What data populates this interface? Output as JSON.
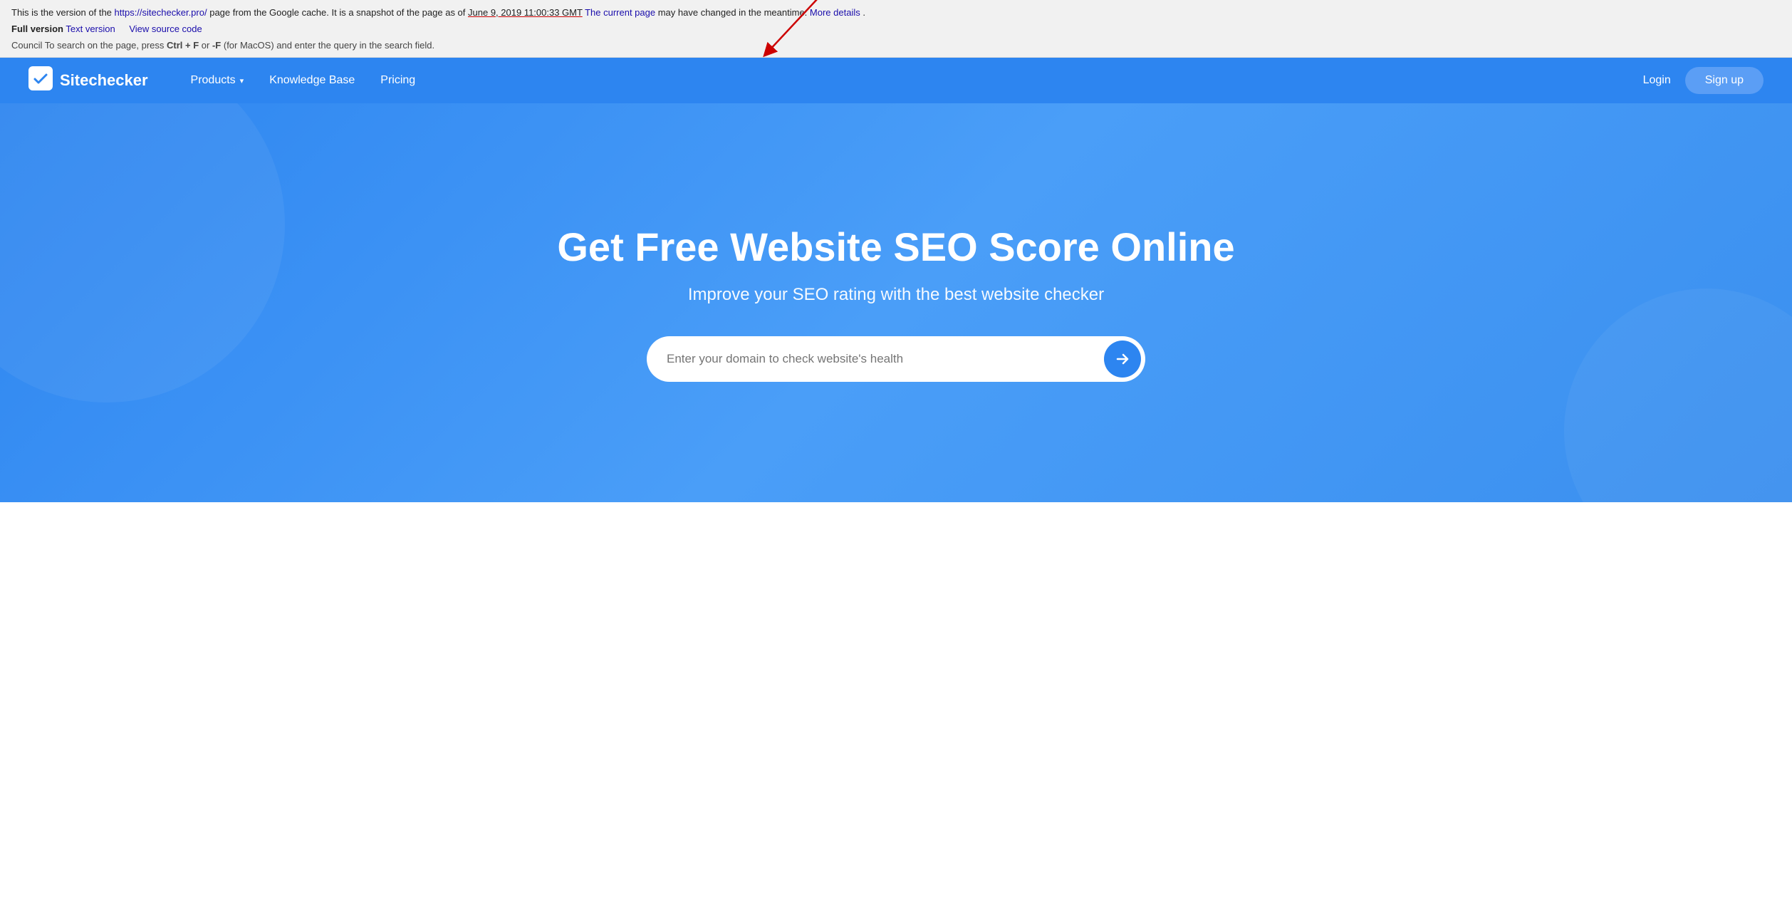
{
  "cache_banner": {
    "line1_prefix": "This is the version of the ",
    "site_url": "https://sitechecker.pro/",
    "line1_middle": " page from the Google cache.  It is a snapshot of the page as of ",
    "snapshot_date": "June 9, 2019 11:00:33 GMT",
    "line1_suffix": ".",
    "current_page_link": "The current page",
    "line1_end": " may have changed in the meantime.",
    "more_details": "More details",
    "full_version": "Full version",
    "text_version": "Text version",
    "view_source": "View source code",
    "tip": "Council To search on the page, press ",
    "tip_ctrl": "Ctrl + F",
    "tip_middle": " or ",
    "tip_f": "-F",
    "tip_end": " (for MacOS) and enter the query in the search field."
  },
  "nav": {
    "logo_text": "Sitechecker",
    "products_label": "Products",
    "knowledge_base_label": "Knowledge Base",
    "pricing_label": "Pricing",
    "login_label": "Login",
    "signup_label": "Sign up"
  },
  "hero": {
    "title": "Get Free Website SEO Score Online",
    "subtitle": "Improve your SEO rating with the best website checker",
    "search_placeholder": "Enter your domain to check website's health"
  }
}
